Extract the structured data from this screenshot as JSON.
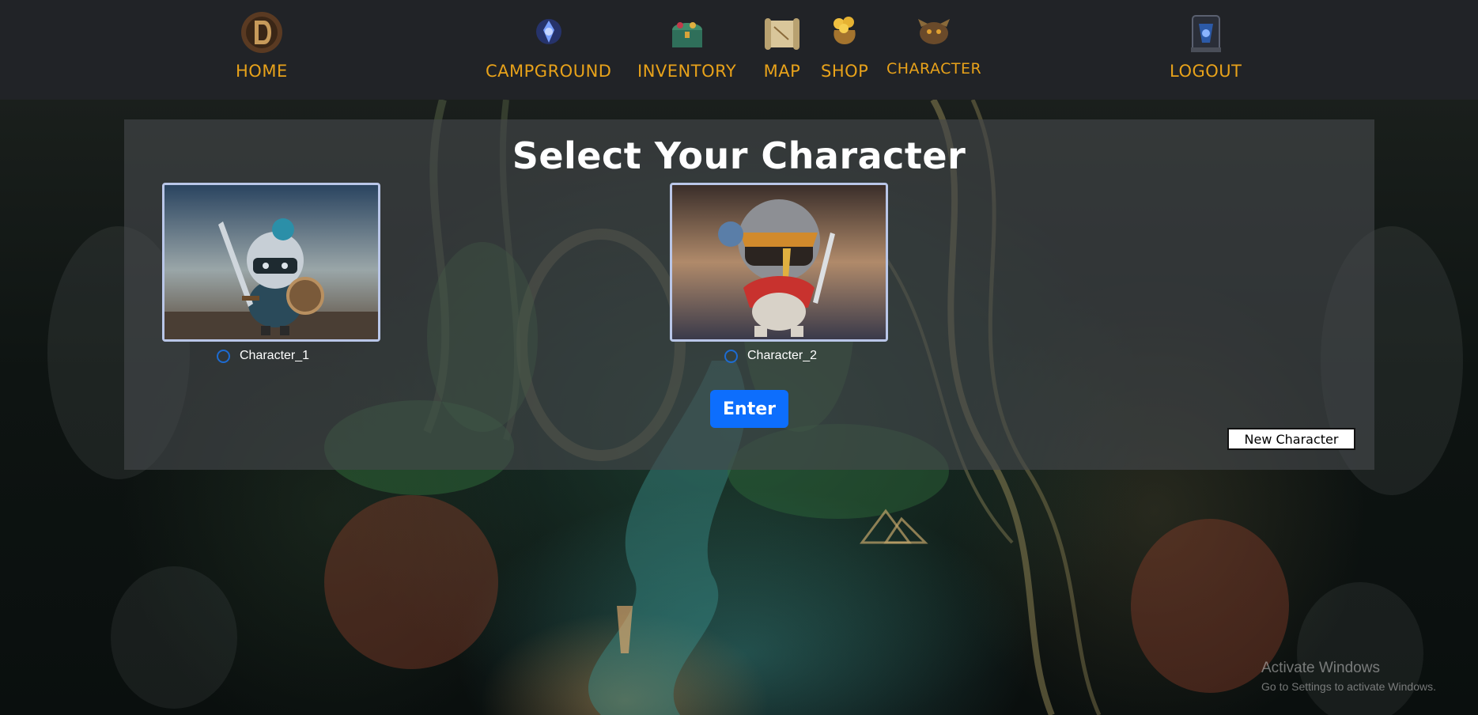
{
  "nav": {
    "home": {
      "label": "HOME",
      "icon": "d-emblem-icon"
    },
    "campground": {
      "label": "CAMPGROUND",
      "icon": "blue-crystal-icon"
    },
    "inventory": {
      "label": "INVENTORY",
      "icon": "treasure-chest-icon"
    },
    "map": {
      "label": "MAP",
      "icon": "scroll-map-icon"
    },
    "shop": {
      "label": "SHOP",
      "icon": "gold-sack-icon"
    },
    "character": {
      "label": "CHARACTER",
      "icon": "monster-head-icon"
    },
    "logout": {
      "label": "LOGOUT",
      "icon": "portal-icon"
    }
  },
  "panel": {
    "title": "Select Your Character",
    "characters": [
      {
        "name": "Character_1",
        "selected": false
      },
      {
        "name": "Character_2",
        "selected": false
      }
    ],
    "enter_label": "Enter",
    "new_character_label": "New Character"
  },
  "watermark": {
    "title": "Activate Windows",
    "subtitle": "Go to Settings to activate Windows."
  },
  "colors": {
    "nav_bg": "#212327",
    "nav_text": "#e8a21a",
    "accent": "#0d6efd",
    "panel_bg": "rgba(70,72,76,0.62)"
  }
}
